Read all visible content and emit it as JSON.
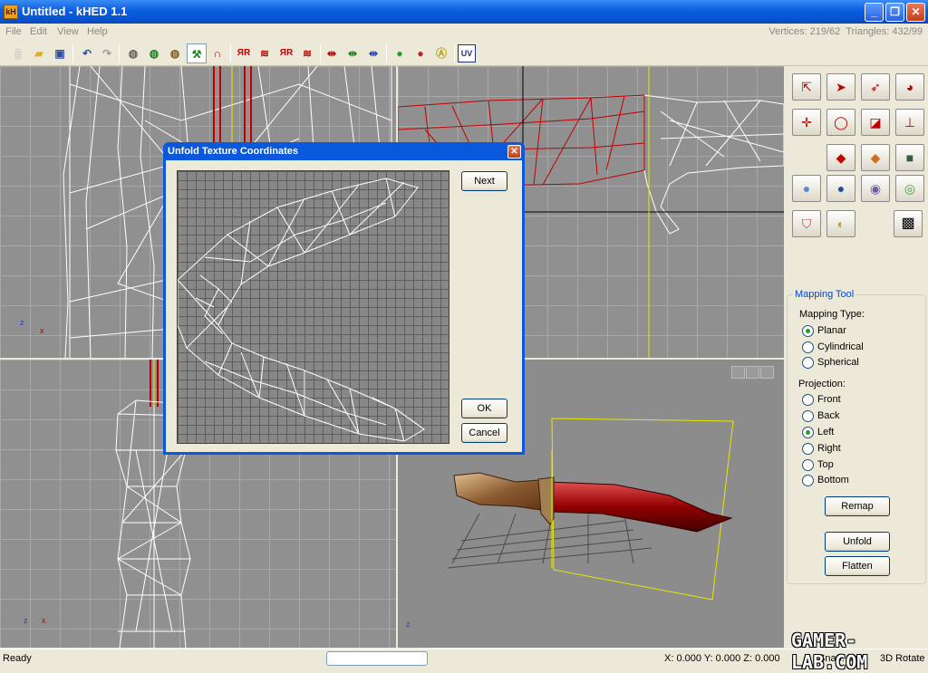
{
  "app": {
    "icon_text": "kH",
    "title": "Untitled - kHED 1.1"
  },
  "window_buttons": {
    "minimize": "_",
    "restore": "❐",
    "close": "✕"
  },
  "menu": {
    "items": [
      "File",
      "Edit",
      "View",
      "Help"
    ]
  },
  "stats": {
    "vertices": "Vertices: 219/62",
    "triangles": "Triangles: 432/99"
  },
  "toolbar": {
    "uv_label": "UV"
  },
  "viewports": {
    "top_left_axis": "x",
    "bottom_left_axis": "x"
  },
  "panel": {
    "mapping_tool": "Mapping Tool",
    "mapping_type_label": "Mapping Type:",
    "mapping_types": [
      {
        "label": "Planar",
        "selected": true
      },
      {
        "label": "Cylindrical",
        "selected": false
      },
      {
        "label": "Spherical",
        "selected": false
      }
    ],
    "projection_label": "Projection:",
    "projections": [
      {
        "label": "Front",
        "selected": false
      },
      {
        "label": "Back",
        "selected": false
      },
      {
        "label": "Left",
        "selected": true
      },
      {
        "label": "Right",
        "selected": false
      },
      {
        "label": "Top",
        "selected": false
      },
      {
        "label": "Bottom",
        "selected": false
      }
    ],
    "remap": "Remap",
    "unfold": "Unfold",
    "flatten": "Flatten"
  },
  "dialog": {
    "title": "Unfold Texture Coordinates",
    "next": "Next",
    "ok": "OK",
    "cancel": "Cancel"
  },
  "status": {
    "ready": "Ready",
    "coords": "X: 0.000 Y: 0.000 Z: 0.000",
    "snap": "Snap: 5.00",
    "rotate": "3D Rotate"
  },
  "watermark": "GAMER-LAB.COM",
  "colors": {
    "titlebar": "#0a5ee0",
    "selection": "#c00000",
    "wire": "#ffffff",
    "dialog_border": "#0a58dc"
  }
}
